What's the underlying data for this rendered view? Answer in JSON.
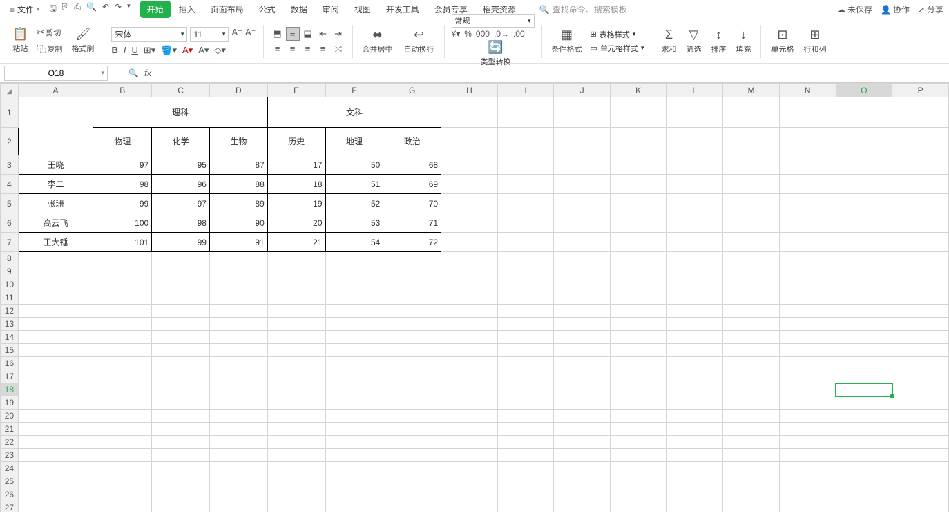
{
  "menu": {
    "file": "文件",
    "tabs": [
      "开始",
      "插入",
      "页面布局",
      "公式",
      "数据",
      "审阅",
      "视图",
      "开发工具",
      "会员专享",
      "稻壳资源"
    ],
    "active_tab": 0,
    "search_placeholder": "查找命令、搜索模板",
    "right": {
      "unsaved": "未保存",
      "collab": "协作",
      "share": "分享"
    }
  },
  "ribbon": {
    "paste": "粘贴",
    "cut": "剪切",
    "copy": "复制",
    "format_painter": "格式刷",
    "font_name": "宋体",
    "font_size": "11",
    "merge": "合并居中",
    "wrap": "自动换行",
    "number_format": "常规",
    "type_convert": "类型转换",
    "cond_fmt": "条件格式",
    "table_style": "表格样式",
    "cell_style": "单元格样式",
    "sum": "求和",
    "filter": "筛选",
    "sort": "排序",
    "fill": "填充",
    "cells": "单元格",
    "rowscols": "行和列"
  },
  "namebox": "O18",
  "formula": "",
  "columns": [
    "A",
    "B",
    "C",
    "D",
    "E",
    "F",
    "G",
    "H",
    "I",
    "J",
    "K",
    "L",
    "M",
    "N",
    "O",
    "P"
  ],
  "row_count": 27,
  "active": {
    "row": 18,
    "col": 14
  },
  "table": {
    "merged_headers": {
      "science": "理科",
      "liberal": "文科"
    },
    "subjects": [
      "物理",
      "化学",
      "生物",
      "历史",
      "地理",
      "政治"
    ],
    "students": [
      {
        "name": "王晓",
        "scores": [
          97,
          95,
          87,
          17,
          50,
          68
        ]
      },
      {
        "name": "李二",
        "scores": [
          98,
          96,
          88,
          18,
          51,
          69
        ]
      },
      {
        "name": "张珊",
        "scores": [
          99,
          97,
          89,
          19,
          52,
          70
        ]
      },
      {
        "name": "高云飞",
        "scores": [
          100,
          98,
          90,
          20,
          53,
          71
        ]
      },
      {
        "name": "王大锤",
        "scores": [
          101,
          99,
          91,
          21,
          54,
          72
        ]
      }
    ]
  }
}
